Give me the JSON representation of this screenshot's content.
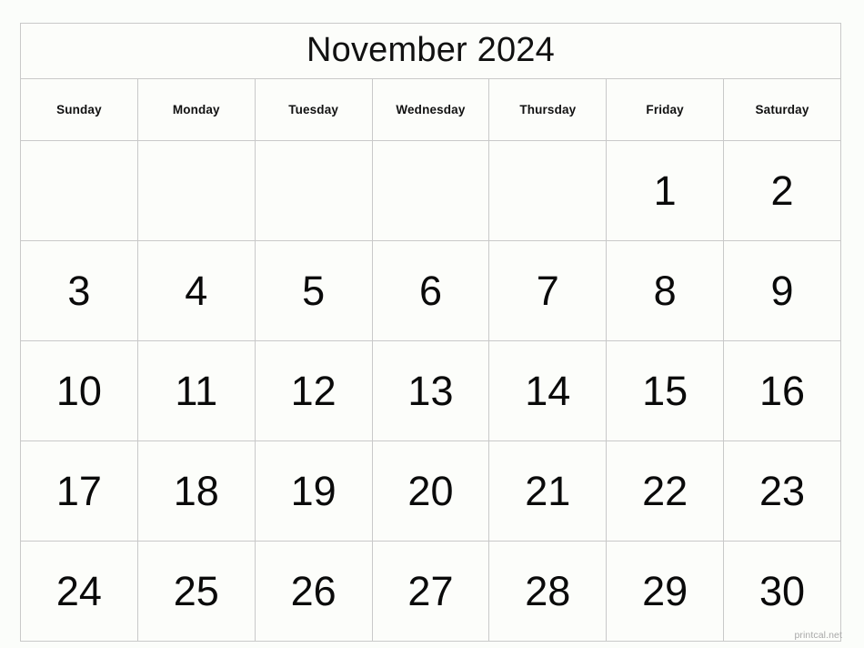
{
  "calendar": {
    "title": "November 2024",
    "month_name": "November",
    "year": "2024",
    "weekday_headers": [
      "Sunday",
      "Monday",
      "Tuesday",
      "Wednesday",
      "Thursday",
      "Friday",
      "Saturday"
    ],
    "weeks": [
      [
        "",
        "",
        "",
        "",
        "",
        "1",
        "2"
      ],
      [
        "3",
        "4",
        "5",
        "6",
        "7",
        "8",
        "9"
      ],
      [
        "10",
        "11",
        "12",
        "13",
        "14",
        "15",
        "16"
      ],
      [
        "17",
        "18",
        "19",
        "20",
        "21",
        "22",
        "23"
      ],
      [
        "24",
        "25",
        "26",
        "27",
        "28",
        "29",
        "30"
      ]
    ]
  },
  "watermark": {
    "text": "printcal.net"
  },
  "colors": {
    "page_background": "#fbfdfa",
    "cell_background": "#fcfdfa",
    "border": "#c9c9c9",
    "text": "#111111",
    "watermark": "#a8a8a8"
  }
}
